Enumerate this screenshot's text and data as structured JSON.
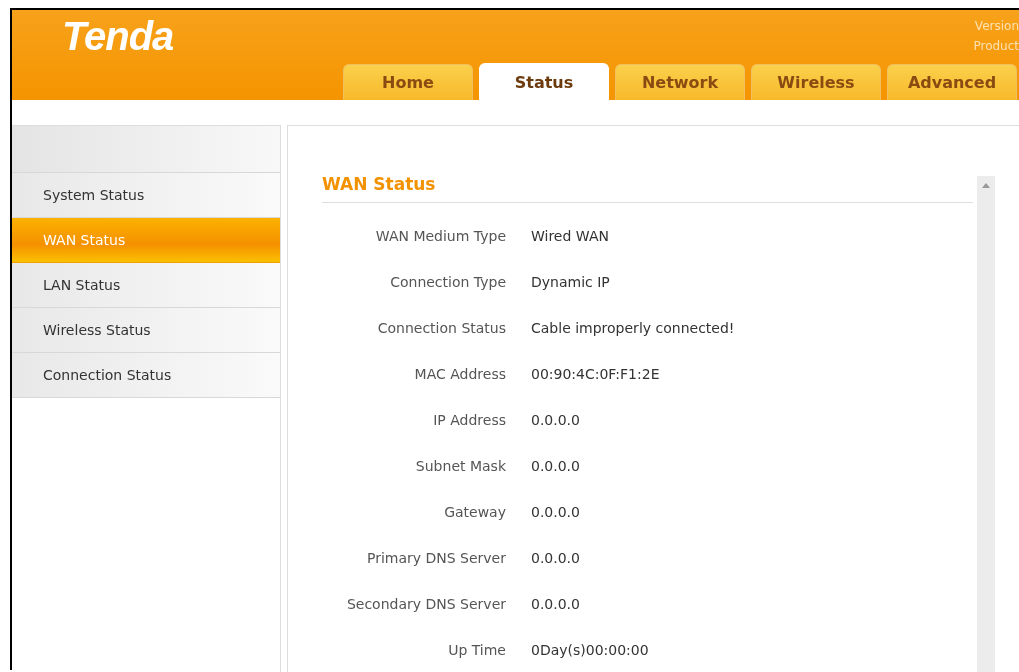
{
  "header": {
    "logo": "Tenda",
    "info_lines": [
      "Version",
      "Product"
    ]
  },
  "tabs": [
    {
      "label": "Home",
      "selected": false
    },
    {
      "label": "Status",
      "selected": true
    },
    {
      "label": "Network",
      "selected": false
    },
    {
      "label": "Wireless",
      "selected": false
    },
    {
      "label": "Advanced",
      "selected": false
    }
  ],
  "sidebar": {
    "items": [
      {
        "label": "System Status",
        "selected": false
      },
      {
        "label": "WAN Status",
        "selected": true
      },
      {
        "label": "LAN Status",
        "selected": false
      },
      {
        "label": "Wireless Status",
        "selected": false
      },
      {
        "label": "Connection Status",
        "selected": false
      }
    ]
  },
  "panel": {
    "title": "WAN Status",
    "fields": [
      {
        "label": "WAN Medium Type",
        "value": "Wired WAN"
      },
      {
        "label": "Connection Type",
        "value": "Dynamic IP"
      },
      {
        "label": "Connection Status",
        "value": "Cable improperly connected!"
      },
      {
        "label": "MAC Address",
        "value": "00:90:4C:0F:F1:2E"
      },
      {
        "label": "IP Address",
        "value": "0.0.0.0"
      },
      {
        "label": "Subnet Mask",
        "value": "0.0.0.0"
      },
      {
        "label": "Gateway",
        "value": "0.0.0.0"
      },
      {
        "label": "Primary DNS Server",
        "value": "0.0.0.0"
      },
      {
        "label": "Secondary DNS Server",
        "value": "0.0.0.0"
      },
      {
        "label": "Up Time",
        "value": "0Day(s)00:00:00"
      }
    ]
  }
}
